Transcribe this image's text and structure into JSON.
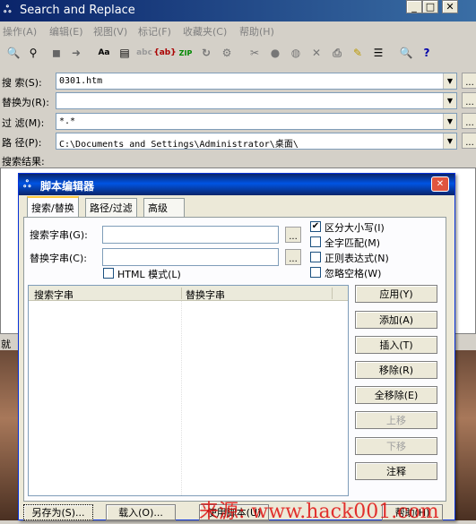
{
  "window": {
    "title": "Search and Replace"
  },
  "titlebar_buttons": {
    "minimize": "_",
    "maximize": "□",
    "close": "✕"
  },
  "menu": [
    "操作(A)",
    "编辑(E)",
    "视图(V)",
    "标记(F)",
    "收藏夹(C)",
    "帮助(H)"
  ],
  "fields": {
    "search_label": "搜  索(S):",
    "search_value": "0301.htm",
    "replace_label": "替换为(R):",
    "replace_value": "",
    "filter_label": "过  滤(M):",
    "filter_value": "*.*",
    "path_label": "路  径(P):",
    "path_value": "C:\\Documents and Settings\\Administrator\\桌面\\",
    "results_label": "搜索结果:",
    "browse": "..."
  },
  "status_partial": "就",
  "dialog": {
    "title": "脚本编辑器",
    "close": "✕",
    "tabs": [
      "搜索/替换",
      "路径/过滤",
      "高级"
    ],
    "search_label": "搜索字串(G):",
    "replace_label": "替换字串(C):",
    "html_mode": "HTML 模式(L)",
    "options": [
      {
        "label": "区分大小写(I)",
        "checked": true
      },
      {
        "label": "全字匹配(M)",
        "checked": false
      },
      {
        "label": "正则表达式(N)",
        "checked": false
      },
      {
        "label": "忽略空格(W)",
        "checked": false
      }
    ],
    "columns": [
      "搜索字串",
      "替换字串"
    ],
    "buttons": {
      "apply": "应用(Y)",
      "add": "添加(A)",
      "insert": "插入(T)",
      "remove": "移除(R)",
      "remove_all": "全移除(E)",
      "up": "上移",
      "down": "下移",
      "comment": "注释"
    },
    "bottom_buttons": {
      "save_as": "另存为(S)...",
      "load": "载入(O)...",
      "use_script": "使用脚本(U)",
      "help": "帮助(H)"
    }
  },
  "watermark": "来源: www.hack001.com"
}
